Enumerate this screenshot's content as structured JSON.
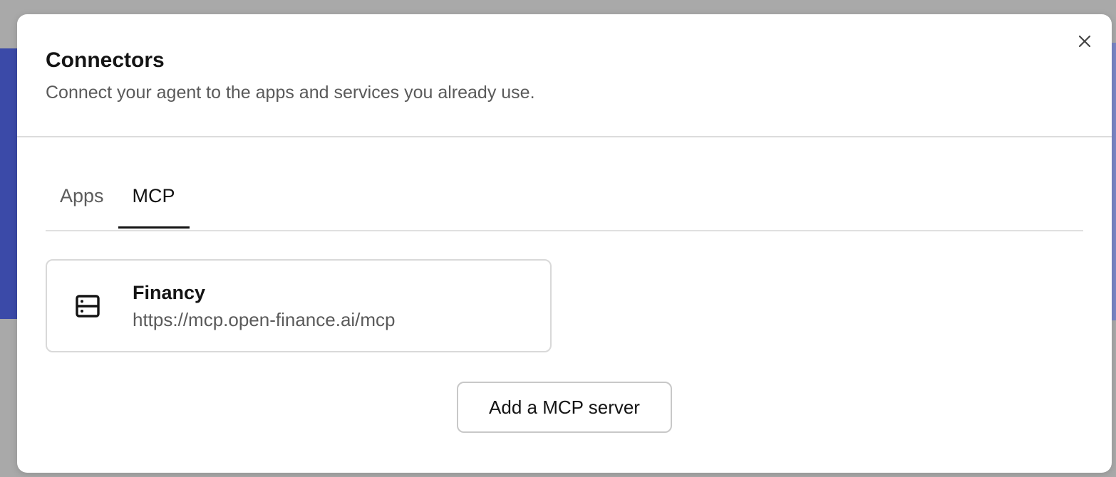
{
  "dialog": {
    "title": "Connectors",
    "subtitle": "Connect your agent to the apps and services you already use.",
    "close_icon": "close-icon"
  },
  "tabs": [
    {
      "label": "Apps",
      "active": false
    },
    {
      "label": "MCP",
      "active": true
    }
  ],
  "servers": [
    {
      "name": "Financy",
      "url": "https://mcp.open-finance.ai/mcp",
      "icon": "server-icon"
    }
  ],
  "actions": {
    "add_server_label": "Add a MCP server"
  },
  "colors": {
    "text_primary": "#141414",
    "text_secondary": "#5a5a5a",
    "border": "#d9d9d9",
    "backdrop": "#a9a9a9"
  }
}
